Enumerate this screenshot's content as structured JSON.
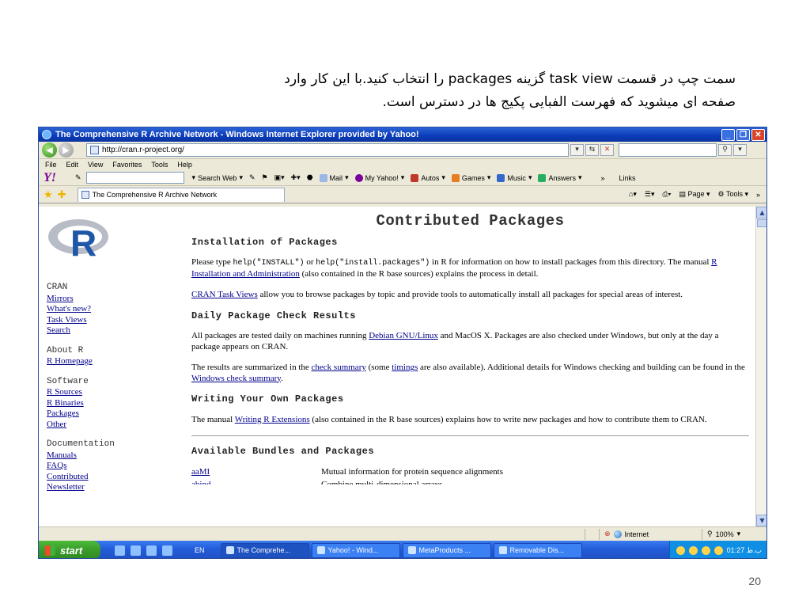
{
  "slide": {
    "caption_line1": "سمت چپ در قسمت task view گزینه packages را انتخاب کنید.با این کار وارد",
    "caption_line2": "صفحه ای میشوید که فهرست الفبایی پکیج ها در دسترس است.",
    "page_number": "20"
  },
  "window": {
    "title": "The Comprehensive R Archive Network - Windows Internet Explorer provided by Yahoo!",
    "address": "http://cran.r-project.org/",
    "menu": [
      "File",
      "Edit",
      "View",
      "Favorites",
      "Tools",
      "Help"
    ],
    "yahoo_logo": "Y!",
    "toolbar": {
      "search_web": "Search Web",
      "mail": "Mail",
      "my_yahoo": "My Yahoo!",
      "autos": "Autos",
      "games": "Games",
      "music": "Music",
      "answers": "Answers",
      "more": "»",
      "links": "Links"
    },
    "tab_title": "The Comprehensive R Archive Network",
    "commands": {
      "page": "Page",
      "tools": "Tools"
    }
  },
  "sidebar": {
    "sections": [
      {
        "heading": "CRAN",
        "links": [
          "Mirrors",
          "What's new?",
          "Task Views",
          "Search"
        ]
      },
      {
        "heading": "About R",
        "links": [
          "R Homepage"
        ]
      },
      {
        "heading": "Software",
        "links": [
          "R Sources",
          "R Binaries",
          "Packages",
          "Other"
        ]
      },
      {
        "heading": "Documentation",
        "links": [
          "Manuals",
          "FAQs",
          "Contributed",
          "Newsletter"
        ]
      }
    ]
  },
  "content": {
    "title": "Contributed Packages",
    "install_heading": "Installation of Packages",
    "install_p1": {
      "t1": "Please type ",
      "code1": "help(\"INSTALL\")",
      "t2": " or ",
      "code2": "help(\"install.packages\")",
      "t3": " in R for information on how to install packages from this directory. The manual ",
      "link1": "R Installation and Administration",
      "t4": " (also contained in the R base sources) explains the process in detail."
    },
    "install_p2": {
      "link1": "CRAN Task Views",
      "t1": " allow you to browse packages by topic and provide tools to automatically install all packages for special areas of interest."
    },
    "check_heading": "Daily Package Check Results",
    "check_p1": {
      "t1": "All packages are tested daily on machines running ",
      "link1": "Debian GNU/Linux",
      "t2": " and MacOS X. Packages are also checked under Windows, but only at the day a package appears on CRAN."
    },
    "check_p2": {
      "t1": "The results are summarized in the ",
      "link1": "check summary",
      "t2": " (some ",
      "link2": "timings",
      "t3": " are also available). Additional details for Windows checking and building can be found in the ",
      "link3": "Windows check summary",
      "t4": "."
    },
    "writing_heading": "Writing Your Own Packages",
    "writing_p1": {
      "t1": "The manual ",
      "link1": "Writing R Extensions",
      "t2": " (also contained in the R base sources) explains how to write new packages and how to contribute them to CRAN."
    },
    "available_heading": "Available Bundles and Packages",
    "packages": [
      {
        "name": "aaMI",
        "desc": "Mutual information for protein sequence alignments"
      },
      {
        "name": "abind",
        "desc": "Combine multi-dimensional arrays"
      }
    ]
  },
  "statusbar": {
    "zone": "Internet",
    "zoom": "100%"
  },
  "taskbar": {
    "start": "start",
    "lang": "EN",
    "tasks": [
      "The Comprehe...",
      "Yahoo! - Wind...",
      "MetaProducts ...",
      "Removable Dis..."
    ],
    "clock": "01:27 ب.ظ"
  },
  "colors": {
    "link": "#00008b",
    "titlebar": "#0a3bb8",
    "taskbar": "#245edb",
    "start": "#3a9a2a"
  }
}
